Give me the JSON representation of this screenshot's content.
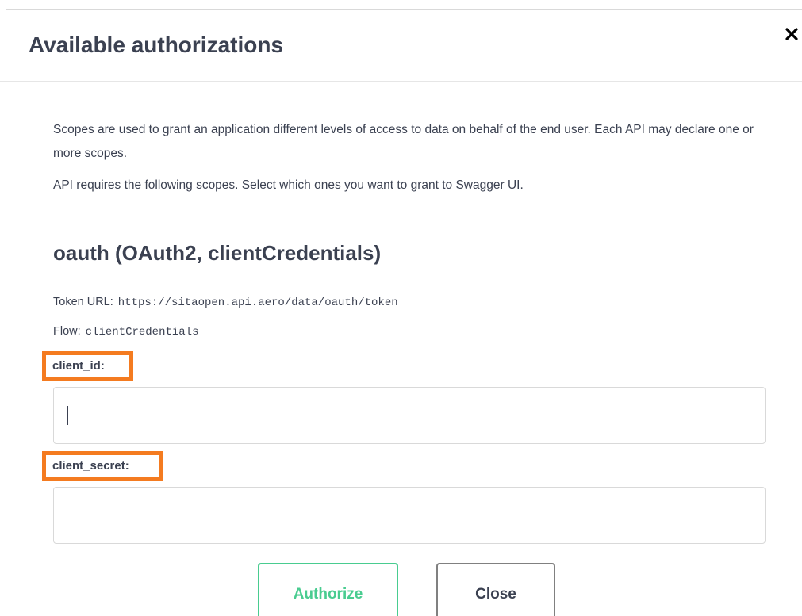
{
  "dialog": {
    "title": "Available authorizations",
    "close_icon": "close-icon"
  },
  "description": {
    "line1": "Scopes are used to grant an application different levels of access to data on behalf of the end user. Each API may declare one or more scopes.",
    "line2": "API requires the following scopes. Select which ones you want to grant to Swagger UI."
  },
  "scheme": {
    "title": "oauth (OAuth2, clientCredentials)",
    "token_url_label": "Token URL:",
    "token_url": "https://sitaopen.api.aero/data/oauth/token",
    "flow_label": "Flow:",
    "flow": "clientCredentials"
  },
  "fields": {
    "client_id_label": "client_id:",
    "client_id_value": "",
    "client_secret_label": "client_secret:",
    "client_secret_value": ""
  },
  "buttons": {
    "authorize": "Authorize",
    "close": "Close"
  },
  "colors": {
    "highlight": "#f47b20",
    "authorize": "#49cc90",
    "text": "#3b4151"
  }
}
